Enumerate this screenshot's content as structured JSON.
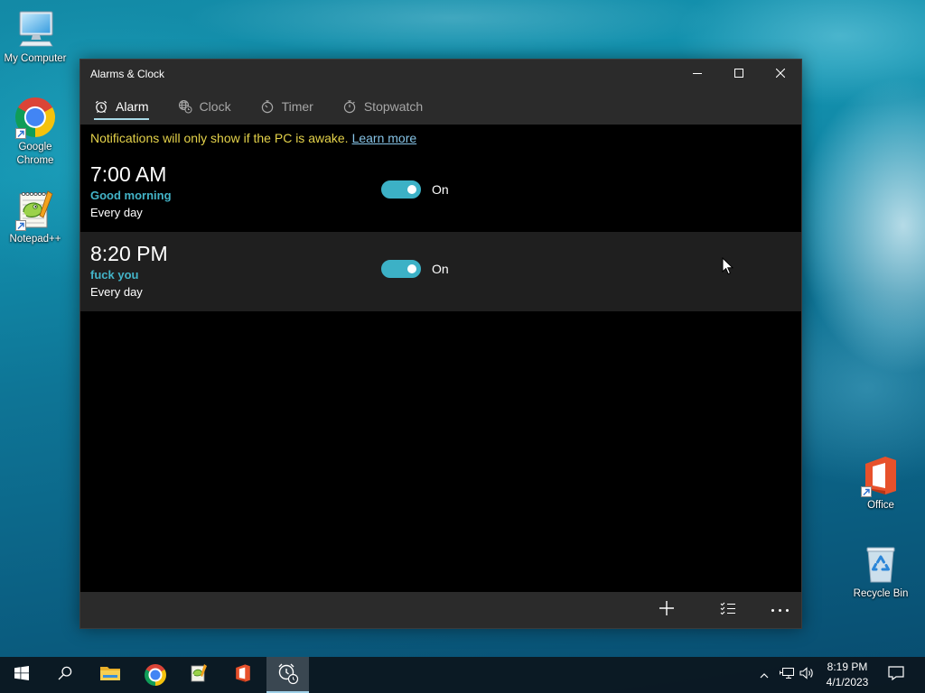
{
  "desktop": {
    "icons": [
      {
        "label": "My Computer",
        "icon": "computer-icon",
        "shortcut": false
      },
      {
        "label": "Google Chrome",
        "icon": "chrome-icon",
        "shortcut": true
      },
      {
        "label": "Notepad++",
        "icon": "notepad-plus-plus-icon",
        "shortcut": true
      },
      {
        "label": "Office",
        "icon": "office-icon",
        "shortcut": true
      },
      {
        "label": "Recycle Bin",
        "icon": "recycle-bin-icon",
        "shortcut": false
      }
    ]
  },
  "window": {
    "title": "Alarms & Clock",
    "controls": [
      "minimize-icon",
      "maximize-icon",
      "close-icon"
    ],
    "tabs": [
      {
        "label": "Alarm",
        "icon": "alarm-icon",
        "active": true
      },
      {
        "label": "Clock",
        "icon": "world-clock-icon",
        "active": false
      },
      {
        "label": "Timer",
        "icon": "timer-icon",
        "active": false
      },
      {
        "label": "Stopwatch",
        "icon": "stopwatch-icon",
        "active": false
      }
    ],
    "notice": {
      "text": "Notifications will only show if the PC is awake.",
      "link": "Learn more"
    },
    "alarms": [
      {
        "time": "7:00 AM",
        "name": "Good morning",
        "repeat": "Every day",
        "enabled": true,
        "state": "On",
        "hovered": false
      },
      {
        "time": "8:20 PM",
        "name": "fuck you",
        "repeat": "Every day",
        "enabled": true,
        "state": "On",
        "hovered": true
      }
    ],
    "command_bar": [
      "add-icon",
      "select-alarms-icon",
      "more-icon"
    ]
  },
  "taskbar": {
    "buttons": [
      {
        "icon": "windows-start-icon",
        "active": false
      },
      {
        "icon": "search-icon",
        "active": false
      },
      {
        "icon": "file-explorer-icon",
        "active": false
      },
      {
        "icon": "chrome-icon",
        "active": false
      },
      {
        "icon": "notepad-plus-plus-icon",
        "active": false
      },
      {
        "icon": "office-icon",
        "active": false
      },
      {
        "icon": "alarms-clock-icon",
        "active": true
      }
    ],
    "tray": {
      "icons": [
        "chevron-up-icon",
        "network-icon",
        "volume-icon",
        "notification-center-icon"
      ],
      "time": "8:19 PM",
      "date": "4/1/2023"
    }
  },
  "colors": {
    "accent": "#3cb1c6",
    "notice_text": "#e4d24a",
    "link": "#86c3e6",
    "alarm_name": "#43b4c8",
    "tab_underline": "#a9d9e6"
  }
}
